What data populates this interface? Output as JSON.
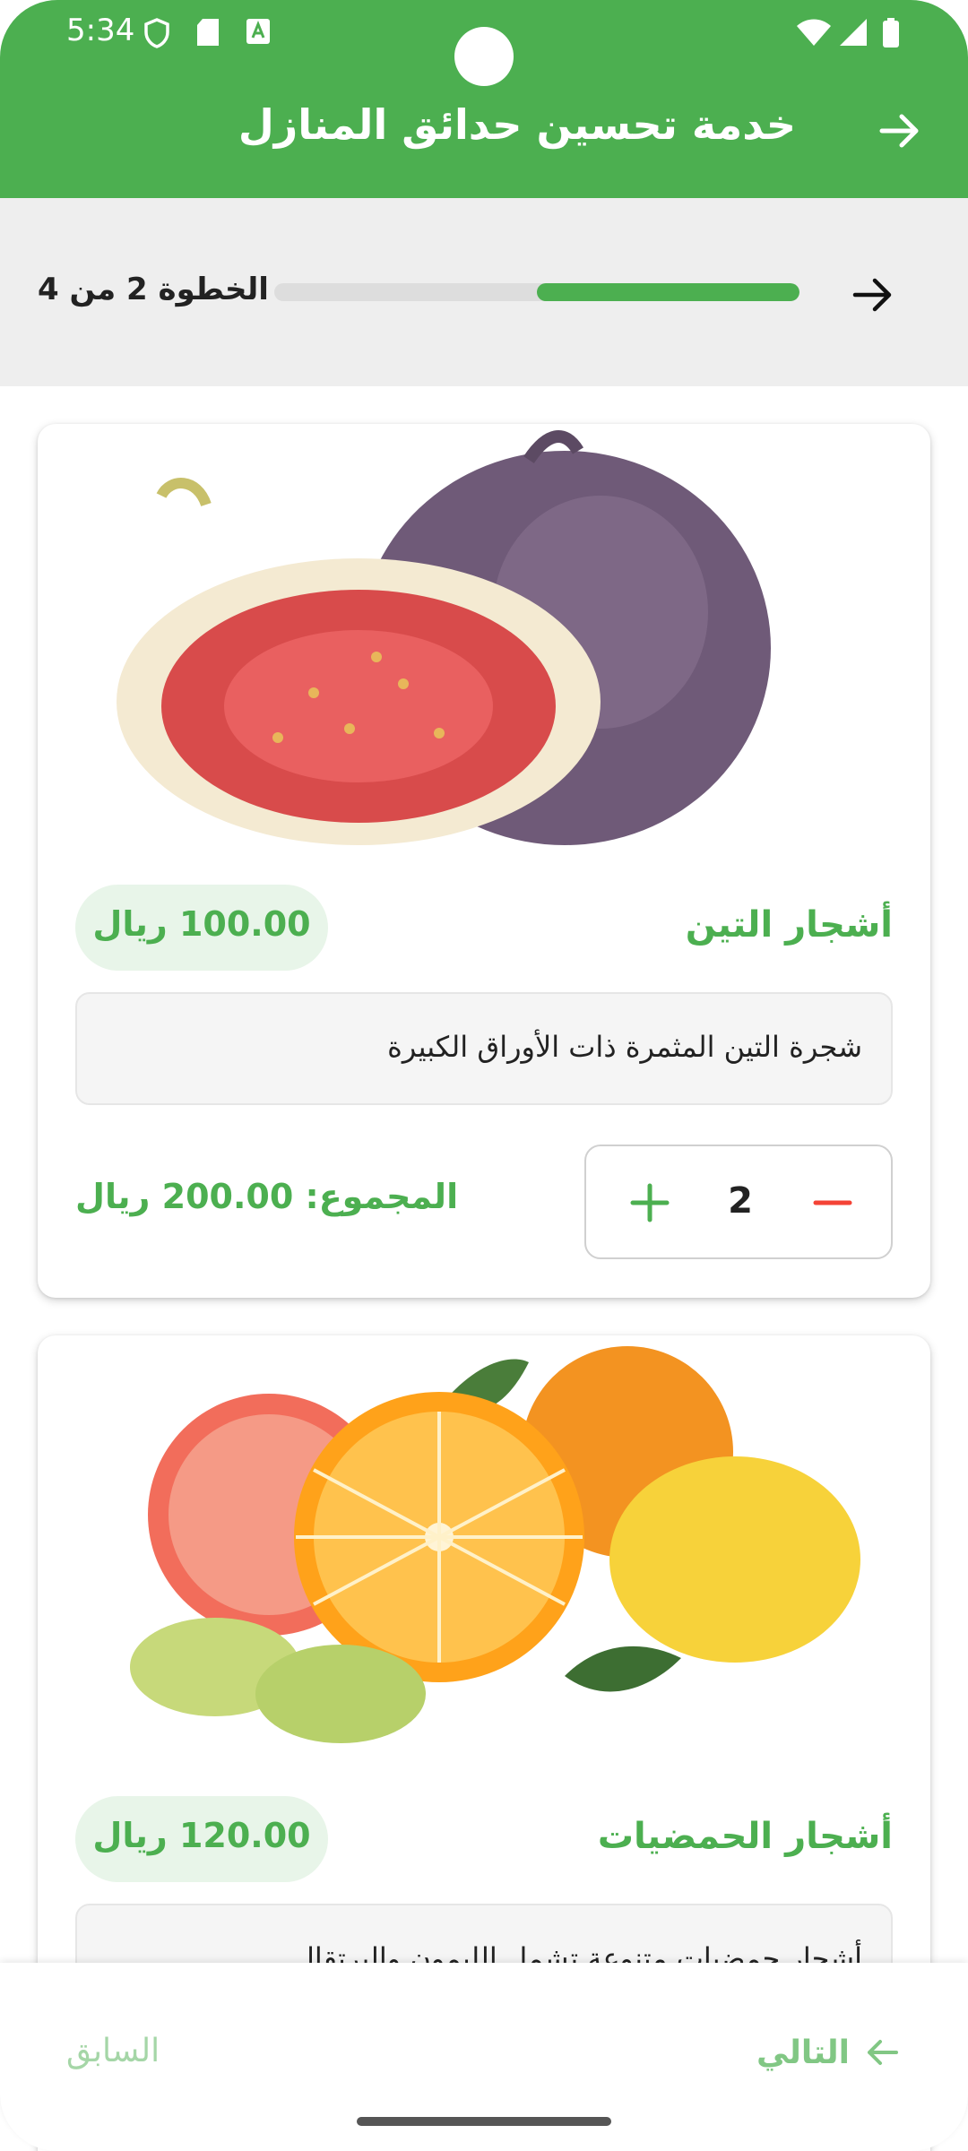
{
  "status_bar": {
    "time": "5:34"
  },
  "header": {
    "title": "خدمة تحسين حدائق المنازل"
  },
  "step": {
    "label": "الخطوة 2 من 4",
    "progress_fraction": 0.5
  },
  "products": [
    {
      "name": "أشجار التين",
      "price": "100.00 ريال",
      "description": "شجرة التين المثمرة ذات الأوراق الكبيرة",
      "quantity": "2",
      "total": "المجموع: 200.00 ريال"
    },
    {
      "name": "أشجار الحمضيات",
      "price": "120.00 ريال",
      "description": "أشجار حمضيات متنوعة تشمل الليمون والبرتقال"
    }
  ],
  "footer": {
    "prev_label": "السابق",
    "next_label": "التالي"
  },
  "colors": {
    "primary": "#4caf50",
    "price_pill_bg": "#e8f5e9",
    "minus": "#f44336",
    "disabled_prev": "#a5d6a7"
  },
  "icons": [
    "arrow-right-icon",
    "plus-icon",
    "minus-icon",
    "arrow-left-icon"
  ]
}
